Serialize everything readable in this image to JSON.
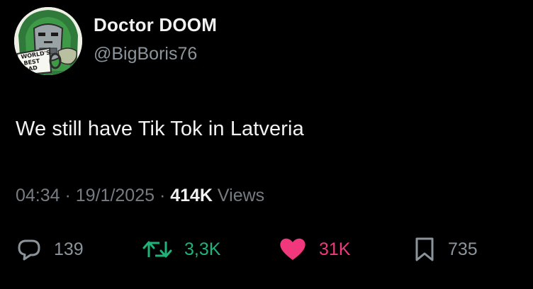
{
  "author": {
    "display_name": "Doctor DOOM",
    "handle": "@BigBoris76",
    "avatar_mug_text": [
      "WORLD'S",
      "BEST",
      "DAD"
    ]
  },
  "tweet": {
    "text": "We still have Tik Tok in Latveria"
  },
  "meta": {
    "time": "04:34",
    "separator": " · ",
    "date": "19/1/2025",
    "views_count": "414K",
    "views_label": " Views"
  },
  "actions": {
    "reply_count": "139",
    "retweet_count": "3,3K",
    "like_count": "31K",
    "bookmark_count": "735"
  },
  "colors": {
    "background": "#000000",
    "text_primary": "#f2f2f2",
    "text_secondary": "#8b949b",
    "retweet": "#1fb37a",
    "like": "#f2387c"
  },
  "icons": {
    "reply": "speech-bubble-icon",
    "retweet": "retweet-arrows-icon",
    "like": "filled-heart-icon",
    "bookmark": "bookmark-icon"
  }
}
